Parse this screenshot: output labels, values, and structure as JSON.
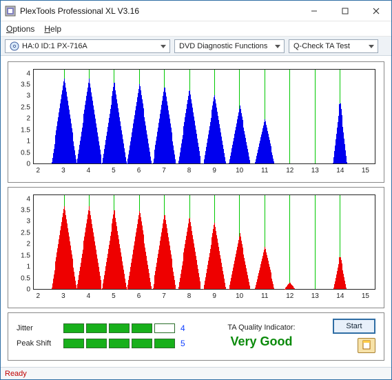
{
  "title": "PlexTools Professional XL V3.16",
  "menu": {
    "options": "Options",
    "help": "Help"
  },
  "toolbar": {
    "device": "HA:0 ID:1  PX-716A",
    "function": "DVD Diagnostic Functions",
    "test": "Q-Check TA Test"
  },
  "bottom": {
    "jitter_label": "Jitter",
    "jitter_value": "4",
    "jitter_boxes": 5,
    "jitter_filled": 4,
    "peak_label": "Peak Shift",
    "peak_value": "5",
    "peak_boxes": 5,
    "peak_filled": 5,
    "quality_label": "TA Quality Indicator:",
    "quality_value": "Very Good",
    "start_label": "Start"
  },
  "status": "Ready",
  "chart_data": [
    {
      "type": "bar",
      "color": "#0000ee",
      "title": "",
      "xlabel": "",
      "ylabel": "",
      "xlim": [
        1.8,
        15.4
      ],
      "ylim": [
        0,
        4.2
      ],
      "xticks": [
        2,
        3,
        4,
        5,
        6,
        7,
        8,
        9,
        10,
        11,
        12,
        13,
        14,
        15
      ],
      "yticks": [
        0,
        0.5,
        1,
        1.5,
        2,
        2.5,
        3,
        3.5,
        4
      ],
      "gridlines_x": [
        3,
        4,
        5,
        6,
        7,
        8,
        9,
        10,
        11,
        12,
        13,
        14
      ],
      "peaks": [
        {
          "center": 3,
          "height": 3.85,
          "halfwidth": 0.5
        },
        {
          "center": 4,
          "height": 3.8,
          "halfwidth": 0.5
        },
        {
          "center": 5,
          "height": 3.65,
          "halfwidth": 0.48
        },
        {
          "center": 6,
          "height": 3.6,
          "halfwidth": 0.48
        },
        {
          "center": 7,
          "height": 3.5,
          "halfwidth": 0.46
        },
        {
          "center": 8,
          "height": 3.35,
          "halfwidth": 0.45
        },
        {
          "center": 9,
          "height": 3.1,
          "halfwidth": 0.44
        },
        {
          "center": 10,
          "height": 2.6,
          "halfwidth": 0.42
        },
        {
          "center": 11,
          "height": 2.0,
          "halfwidth": 0.38
        },
        {
          "center": 14,
          "height": 2.8,
          "halfwidth": 0.28
        }
      ]
    },
    {
      "type": "bar",
      "color": "#ee0000",
      "title": "",
      "xlabel": "",
      "ylabel": "",
      "xlim": [
        1.8,
        15.4
      ],
      "ylim": [
        0,
        4.2
      ],
      "xticks": [
        2,
        3,
        4,
        5,
        6,
        7,
        8,
        9,
        10,
        11,
        12,
        13,
        14,
        15
      ],
      "yticks": [
        0,
        0.5,
        1,
        1.5,
        2,
        2.5,
        3,
        3.5,
        4
      ],
      "gridlines_x": [
        3,
        4,
        5,
        6,
        7,
        8,
        9,
        10,
        11,
        12,
        13,
        14
      ],
      "peaks": [
        {
          "center": 3,
          "height": 3.75,
          "halfwidth": 0.5
        },
        {
          "center": 4,
          "height": 3.7,
          "halfwidth": 0.5
        },
        {
          "center": 5,
          "height": 3.55,
          "halfwidth": 0.48
        },
        {
          "center": 6,
          "height": 3.55,
          "halfwidth": 0.48
        },
        {
          "center": 7,
          "height": 3.4,
          "halfwidth": 0.46
        },
        {
          "center": 8,
          "height": 3.25,
          "halfwidth": 0.45
        },
        {
          "center": 9,
          "height": 3.0,
          "halfwidth": 0.44
        },
        {
          "center": 10,
          "height": 2.5,
          "halfwidth": 0.42
        },
        {
          "center": 11,
          "height": 1.9,
          "halfwidth": 0.38
        },
        {
          "center": 12,
          "height": 0.3,
          "halfwidth": 0.2
        },
        {
          "center": 14,
          "height": 1.5,
          "halfwidth": 0.26
        }
      ]
    }
  ]
}
